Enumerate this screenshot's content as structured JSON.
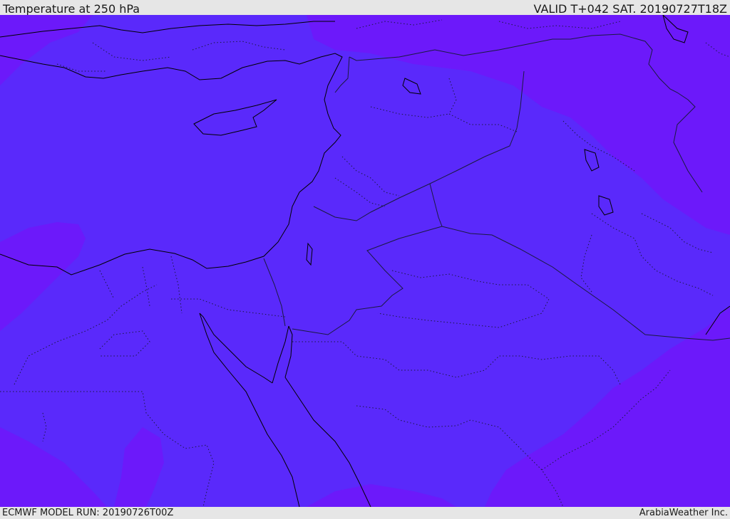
{
  "header": {
    "title": "Temperature at 250 hPa",
    "valid": "VALID T+042 SAT. 20190727T18Z"
  },
  "footer": {
    "model_run": "ECMWF MODEL RUN: 20190726T00Z",
    "credit": "ArabiaWeather Inc."
  },
  "map": {
    "colors": {
      "base_field": "#5a29fb",
      "cold_field": "#6c19fa",
      "coastline": "#000000",
      "borders": "#1a1a40"
    },
    "features": [
      "temperature-field",
      "coastlines",
      "country-borders",
      "province-borders"
    ]
  }
}
